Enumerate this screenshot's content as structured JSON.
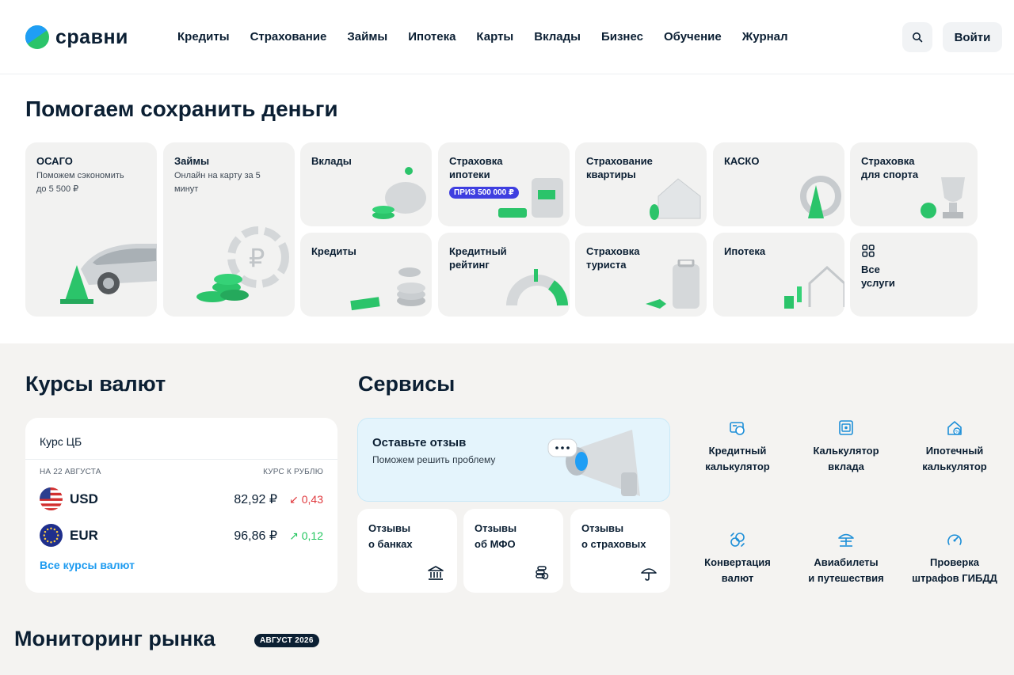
{
  "header": {
    "logo_text": "сравни",
    "nav": [
      "Кредиты",
      "Страхование",
      "Займы",
      "Ипотека",
      "Карты",
      "Вклады",
      "Бизнес",
      "Обучение",
      "Журнал"
    ],
    "login_label": "Войти"
  },
  "hero": {
    "title": "Помогаем сохранить деньги",
    "cards": [
      {
        "title": "ОСАГО",
        "subtitle": "Поможем сэкономить\nдо 5 500 ₽"
      },
      {
        "title": "Займы",
        "subtitle": "Онлайн на карту за 5\nминут"
      },
      {
        "title": "Вклады"
      },
      {
        "title": "Страховка\nипотеки",
        "badge": "ПРИЗ 500 000 ₽"
      },
      {
        "title": "Страхование\nквартиры"
      },
      {
        "title": "КАСКО"
      },
      {
        "title": "Страховка\nдля спорта"
      },
      {
        "title": "Кредиты"
      },
      {
        "title": "Кредитный\nрейтинг"
      },
      {
        "title": "Страховка\nтуриста"
      },
      {
        "title": "Ипотека"
      },
      {
        "title": "Все\nуслуги"
      }
    ]
  },
  "rates": {
    "title": "Курсы валют",
    "card_title": "Курс ЦБ",
    "date_label": "НА 22 АВГУСТА",
    "col_label": "КУРС К РУБЛЮ",
    "rows": [
      {
        "code": "USD",
        "value": "82,92 ₽",
        "change": "↙ 0,43",
        "direction": "down"
      },
      {
        "code": "EUR",
        "value": "96,86 ₽",
        "change": "↗ 0,12",
        "direction": "up"
      }
    ],
    "all_link": "Все курсы валют"
  },
  "services": {
    "title": "Сервисы",
    "review": {
      "title": "Оставьте отзыв",
      "subtitle": "Поможем решить проблему"
    },
    "review_cards": [
      {
        "label": "Отзывы\nо банках",
        "icon": "bank-icon"
      },
      {
        "label": "Отзывы\nоб МФО",
        "icon": "coins-icon"
      },
      {
        "label": "Отзывы\nо страховых",
        "icon": "umbrella-icon"
      }
    ],
    "tools": [
      {
        "label": "Кредитный\nкалькулятор",
        "icon": "credit-calculator-icon"
      },
      {
        "label": "Калькулятор\nвклада",
        "icon": "safe-icon"
      },
      {
        "label": "Ипотечный\nкалькулятор",
        "icon": "house-percent-icon"
      },
      {
        "label": "Конвертация\nвалют",
        "icon": "currency-exchange-icon"
      },
      {
        "label": "Авиабилеты\nи путешествия",
        "icon": "beach-umbrella-icon"
      },
      {
        "label": "Проверка\nштрафов ГИБДД",
        "icon": "speedometer-icon"
      }
    ]
  },
  "monitoring": {
    "title": "Мониторинг рынка",
    "badge": "АВГУСТ 2026"
  },
  "colors": {
    "brand_green": "#2bc46a",
    "brand_blue": "#1f9ef5",
    "link": "#1d9bf0",
    "icon_blue": "#1d8fd8",
    "down": "#e0393e",
    "up": "#22c55e"
  }
}
